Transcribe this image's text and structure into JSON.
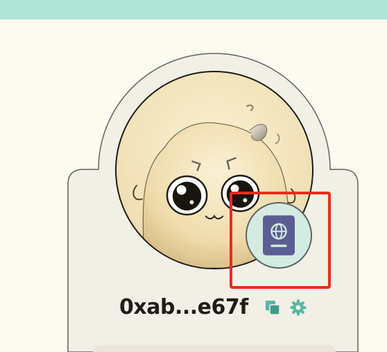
{
  "colors": {
    "top_bar": "#ade4d6",
    "page_background": "#fdfbef",
    "card_background": "#f2efe6",
    "card_border": "#5c6366",
    "accent_teal": "#56b8a3",
    "badge_background": "#d4ebe2",
    "passport_purple": "#5b5e93",
    "highlight_red": "#ee2a1c"
  },
  "profile": {
    "avatar": {
      "name": "avatar-image",
      "description_icon": "cartoon-creature-avatar"
    },
    "passport_badge": {
      "icon": "passport-globe-icon"
    },
    "address": "0xab...e67f",
    "actions": {
      "copy_icon": "copy-icon",
      "settings_icon": "gear-icon"
    }
  }
}
